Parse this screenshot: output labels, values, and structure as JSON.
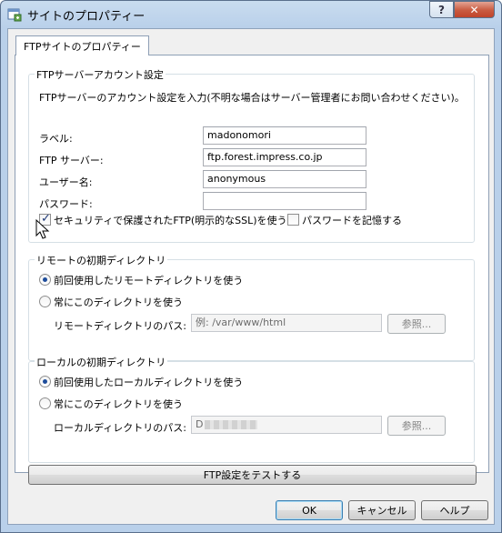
{
  "window": {
    "title": "サイトのプロパティー",
    "help_label": "?",
    "close_label": "✕"
  },
  "tab": {
    "label": "FTPサイトのプロパティー"
  },
  "account": {
    "legend": "FTPサーバーアカウント設定",
    "description": "FTPサーバーのアカウント設定を入力(不明な場合はサーバー管理者にお問い合わせください)。",
    "label_label": "ラベル:",
    "label_value": "madonomori",
    "server_label": "FTP サーバー:",
    "server_value": "ftp.forest.impress.co.jp",
    "user_label": "ユーザー名:",
    "user_value": "anonymous",
    "password_label": "パスワード:",
    "password_value": "",
    "ssl_label": "セキュリティで保護されたFTP(明示的なSSL)を使う",
    "ssl_checked": true,
    "remember_label": "パスワードを記憶する",
    "remember_checked": false
  },
  "remote": {
    "legend": "リモートの初期ディレクトリ",
    "option_last": "前回使用したリモートディレクトリを使う",
    "option_fixed": "常にこのディレクトリを使う",
    "selected": "last",
    "path_label": "リモートディレクトリのパス:",
    "path_placeholder": "例:  /var/www/html",
    "browse_label": "参照..."
  },
  "local": {
    "legend": "ローカルの初期ディレクトリ",
    "option_last": "前回使用したローカルディレクトリを使う",
    "option_fixed": "常にこのディレクトリを使う",
    "selected": "last",
    "path_label": "ローカルディレクトリのパス:",
    "path_value": "D",
    "browse_label": "参照..."
  },
  "test_button": "FTP設定をテストする",
  "buttons": {
    "ok": "OK",
    "cancel": "キャンセル",
    "help": "ヘルプ"
  }
}
